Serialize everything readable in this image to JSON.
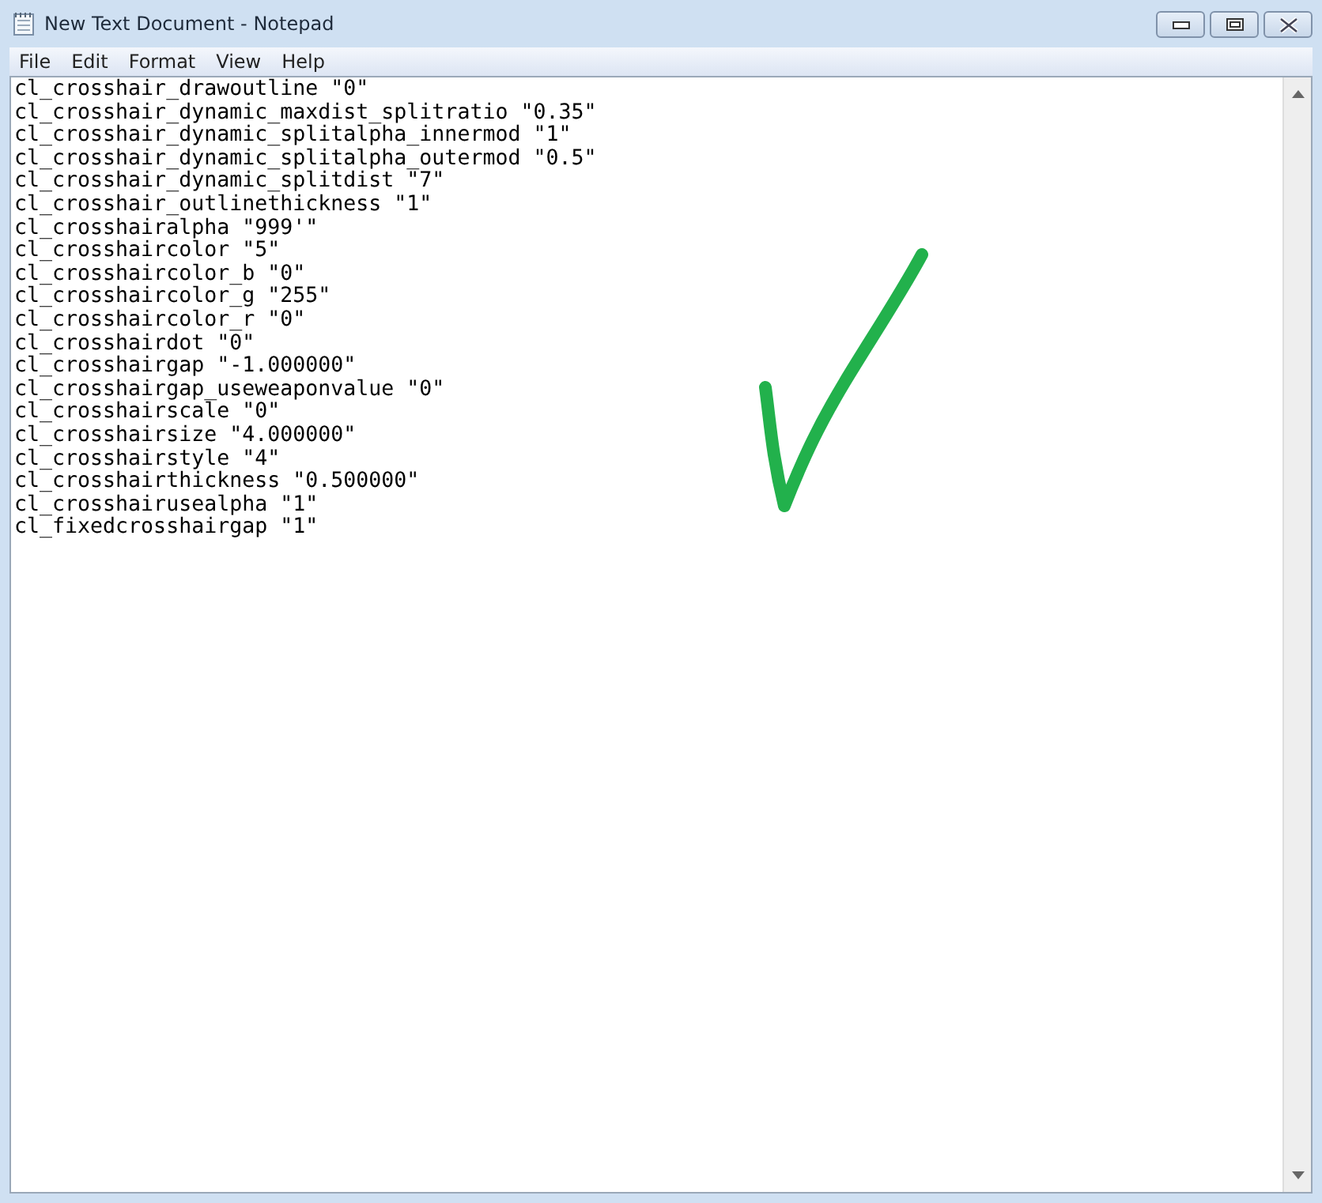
{
  "window": {
    "title": "New Text Document - Notepad"
  },
  "menu": [
    "File",
    "Edit",
    "Format",
    "View",
    "Help"
  ],
  "document": {
    "lines": [
      "cl_crosshair_drawoutline \"0\"",
      "cl_crosshair_dynamic_maxdist_splitratio \"0.35\"",
      "cl_crosshair_dynamic_splitalpha_innermod \"1\"",
      "cl_crosshair_dynamic_splitalpha_outermod \"0.5\"",
      "cl_crosshair_dynamic_splitdist \"7\"",
      "cl_crosshair_outlinethickness \"1\"",
      "cl_crosshairalpha \"999'\"",
      "cl_crosshaircolor \"5\"",
      "cl_crosshaircolor_b \"0\"",
      "cl_crosshaircolor_g \"255\"",
      "cl_crosshaircolor_r \"0\"",
      "cl_crosshairdot \"0\"",
      "cl_crosshairgap \"-1.000000\"",
      "cl_crosshairgap_useweaponvalue \"0\"",
      "cl_crosshairscale \"0\"",
      "cl_crosshairsize \"4.000000\"",
      "cl_crosshairstyle \"4\"",
      "cl_crosshairthickness \"0.500000\"",
      "cl_crosshairusealpha \"1\"",
      "cl_fixedcrosshairgap \"1\""
    ]
  }
}
